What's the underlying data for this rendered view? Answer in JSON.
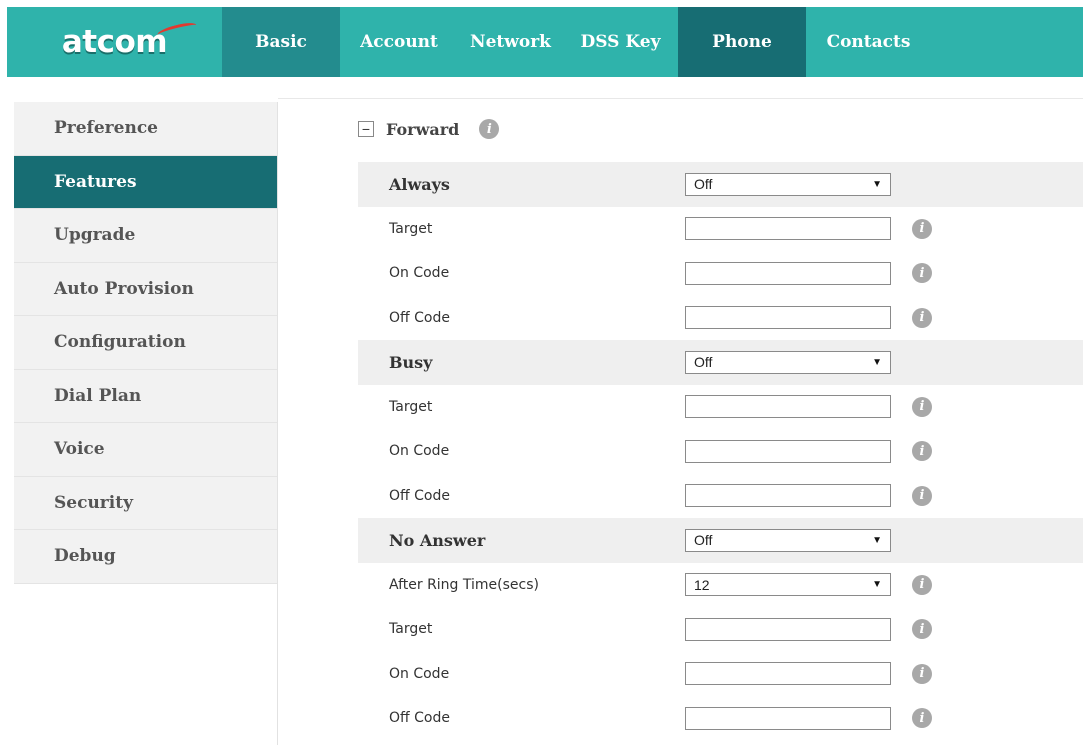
{
  "brand": {
    "logo_text": "atcom"
  },
  "nav": {
    "items": [
      {
        "label": "Basic"
      },
      {
        "label": "Account"
      },
      {
        "label": "Network"
      },
      {
        "label": "DSS Key"
      },
      {
        "label": "Phone"
      },
      {
        "label": "Contacts"
      }
    ],
    "active": "Phone",
    "highlighted": "Basic"
  },
  "sidebar": {
    "items": [
      {
        "label": "Preference"
      },
      {
        "label": "Features"
      },
      {
        "label": "Upgrade"
      },
      {
        "label": "Auto Provision"
      },
      {
        "label": "Configuration"
      },
      {
        "label": "Dial Plan"
      },
      {
        "label": "Voice"
      },
      {
        "label": "Security"
      },
      {
        "label": "Debug"
      }
    ],
    "active": "Features"
  },
  "section": {
    "title": "Forward",
    "collapse_symbol": "−",
    "info_symbol": "i"
  },
  "form": {
    "always": {
      "label": "Always",
      "value": "Off",
      "target_label": "Target",
      "target_value": "",
      "on_code_label": "On Code",
      "on_code_value": "",
      "off_code_label": "Off Code",
      "off_code_value": ""
    },
    "busy": {
      "label": "Busy",
      "value": "Off",
      "target_label": "Target",
      "target_value": "",
      "on_code_label": "On Code",
      "on_code_value": "",
      "off_code_label": "Off Code",
      "off_code_value": ""
    },
    "no_answer": {
      "label": "No Answer",
      "value": "Off",
      "ring_time_label": "After Ring Time(secs)",
      "ring_time_value": "12",
      "target_label": "Target",
      "target_value": "",
      "on_code_label": "On Code",
      "on_code_value": "",
      "off_code_label": "Off Code",
      "off_code_value": ""
    },
    "select_arrow": "▼"
  },
  "colors": {
    "nav_bg": "#2fb3ab",
    "nav_basic": "#238c8e",
    "nav_active": "#176d73",
    "sidebar_active": "#176d73",
    "group_row": "#efefef"
  },
  "icons": {
    "info": "info-icon",
    "collapse": "minus-icon",
    "dropdown": "chevron-down-icon"
  }
}
